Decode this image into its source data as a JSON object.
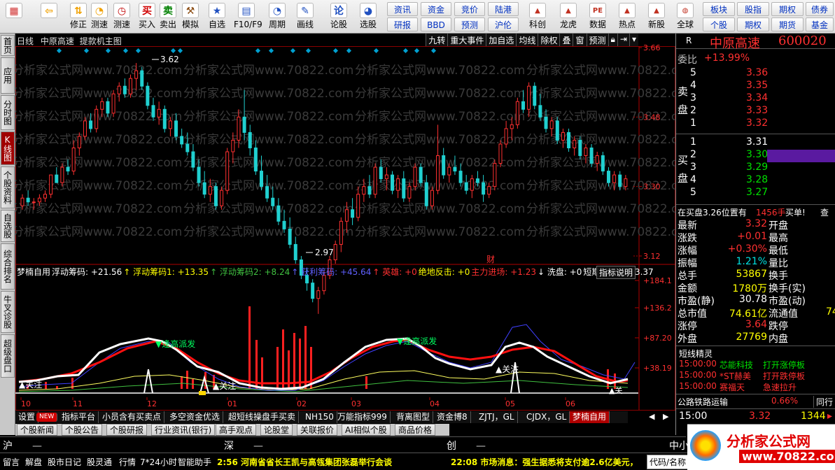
{
  "toolbar": {
    "big_buttons": [
      {
        "label": "",
        "icon": "colored-blocks-icon",
        "color": "#d03030"
      },
      {
        "label": "",
        "icon": "back-arrow-icon",
        "color": "#f0a000"
      },
      {
        "label": "修正",
        "icon": "up-down-arrow-icon",
        "color": "#f0a000"
      },
      {
        "label": "测速",
        "icon": "timer-icon",
        "color": "#f0a000"
      },
      {
        "label": "测速",
        "icon": "clock-icon",
        "color": "#c00000"
      },
      {
        "label": "买入",
        "icon": "buy-icon",
        "text": "买",
        "color": "#d00000"
      },
      {
        "label": "卖出",
        "icon": "sell-icon",
        "text": "卖",
        "color": "#008000"
      },
      {
        "label": "模拟",
        "icon": "hammer-icon",
        "color": "#8a4a10"
      },
      {
        "label": "自选",
        "icon": "star-icon",
        "color": "#2050c0"
      },
      {
        "label": "F10/F9",
        "icon": "f10-icon",
        "color": "#2050c0"
      },
      {
        "label": "周期",
        "icon": "period-clock-icon",
        "color": "#2050c0"
      },
      {
        "label": "画线",
        "icon": "pencil-icon",
        "color": "#2050c0"
      },
      {
        "label": "论股",
        "icon": "discuss-icon",
        "text": "论",
        "color": "#2050c0"
      },
      {
        "label": "选股",
        "icon": "speedometer-icon",
        "color": "#2050c0"
      }
    ],
    "small_buttons_col1": [
      "资讯",
      "研报"
    ],
    "small_buttons_col2": [
      "资金",
      "BBD"
    ],
    "small_buttons_col3": [
      "竞价",
      "预测"
    ],
    "small_buttons_col4": [
      "陆港",
      "沪伦"
    ],
    "right_buttons": [
      {
        "label": "科创",
        "icon": "stock-chart-icon"
      },
      {
        "label": "龙虎",
        "icon": "dragon-chart-icon"
      },
      {
        "label": "数据",
        "icon": "pe-data-icon"
      },
      {
        "label": "热点",
        "icon": "hot-icon"
      },
      {
        "label": "新股",
        "icon": "ipo-icon"
      },
      {
        "label": "全球",
        "icon": "globe-icon"
      }
    ],
    "far_right": [
      [
        "板块",
        "个股"
      ],
      [
        "股指",
        "期权"
      ],
      [
        "期权",
        "期货"
      ],
      [
        "债券",
        "基金"
      ]
    ]
  },
  "left_tabs": [
    "首页",
    "应用",
    "分时图",
    "K线图",
    "个股资料",
    "自选股",
    "综合排名",
    "牛叉诊股",
    "超级盘口"
  ],
  "active_left_tab": "K线图",
  "chart": {
    "period": "日线",
    "stock_name": "中原高速",
    "template": "提款机主图",
    "menu": [
      "九转",
      "重大事件",
      "加自选",
      "均线",
      "除权",
      "叠",
      "窗",
      "预测"
    ],
    "high_label": "3.62",
    "low_label": "2.97",
    "event_mark": "财",
    "price_axis": [
      "3.66",
      "3.48",
      "3.30",
      "3.12"
    ],
    "months": [
      "10",
      "11",
      "12",
      "01",
      "02",
      "03",
      "04",
      "05",
      "06"
    ],
    "watermark": "分析家公式网www.70822.com",
    "candles": [
      [
        3.25,
        3.28,
        3.24,
        3.27
      ],
      [
        3.27,
        3.29,
        3.25,
        3.26
      ],
      [
        3.26,
        3.27,
        3.24,
        3.26
      ],
      [
        3.26,
        3.28,
        3.25,
        3.27
      ],
      [
        3.27,
        3.29,
        3.26,
        3.28
      ],
      [
        3.28,
        3.33,
        3.27,
        3.33
      ],
      [
        3.33,
        3.35,
        3.31,
        3.31
      ],
      [
        3.31,
        3.36,
        3.3,
        3.35
      ],
      [
        3.35,
        3.37,
        3.33,
        3.34
      ],
      [
        3.34,
        3.42,
        3.33,
        3.4
      ],
      [
        3.4,
        3.44,
        3.38,
        3.43
      ],
      [
        3.43,
        3.48,
        3.42,
        3.47
      ],
      [
        3.47,
        3.49,
        3.44,
        3.45
      ],
      [
        3.45,
        3.51,
        3.44,
        3.5
      ],
      [
        3.5,
        3.53,
        3.48,
        3.52
      ],
      [
        3.52,
        3.53,
        3.48,
        3.49
      ],
      [
        3.49,
        3.55,
        3.48,
        3.54
      ],
      [
        3.54,
        3.57,
        3.52,
        3.56
      ],
      [
        3.56,
        3.58,
        3.53,
        3.54
      ],
      [
        3.54,
        3.59,
        3.53,
        3.58
      ],
      [
        3.58,
        3.62,
        3.55,
        3.6
      ],
      [
        3.6,
        3.61,
        3.55,
        3.56
      ],
      [
        3.56,
        3.57,
        3.5,
        3.51
      ],
      [
        3.51,
        3.53,
        3.47,
        3.48
      ],
      [
        3.48,
        3.52,
        3.46,
        3.5
      ],
      [
        3.5,
        3.51,
        3.44,
        3.45
      ],
      [
        3.45,
        3.48,
        3.43,
        3.47
      ],
      [
        3.47,
        3.49,
        3.42,
        3.43
      ],
      [
        3.43,
        3.45,
        3.4,
        3.41
      ],
      [
        3.41,
        3.44,
        3.38,
        3.39
      ],
      [
        3.39,
        3.41,
        3.34,
        3.35
      ],
      [
        3.35,
        3.37,
        3.3,
        3.31
      ],
      [
        3.31,
        3.34,
        3.27,
        3.28
      ],
      [
        3.28,
        3.32,
        3.26,
        3.3
      ],
      [
        3.3,
        3.31,
        3.24,
        3.25
      ],
      [
        3.25,
        3.3,
        3.24,
        3.29
      ],
      [
        3.29,
        3.4,
        3.28,
        3.39
      ],
      [
        3.39,
        3.44,
        3.36,
        3.42
      ],
      [
        3.42,
        3.5,
        3.4,
        3.48
      ],
      [
        3.48,
        3.55,
        3.42,
        3.44
      ],
      [
        3.44,
        3.46,
        3.38,
        3.4
      ],
      [
        3.4,
        3.42,
        3.33,
        3.34
      ],
      [
        3.34,
        3.38,
        3.29,
        3.3
      ],
      [
        3.3,
        3.33,
        3.26,
        3.27
      ],
      [
        3.27,
        3.3,
        3.24,
        3.25
      ],
      [
        3.25,
        3.27,
        3.2,
        3.21
      ],
      [
        3.21,
        3.24,
        3.18,
        3.19
      ],
      [
        3.19,
        3.22,
        3.14,
        3.15
      ],
      [
        3.15,
        3.17,
        3.1,
        3.11
      ],
      [
        3.11,
        3.12,
        3.06,
        3.07
      ],
      [
        3.07,
        3.09,
        3.03,
        3.05
      ],
      [
        3.05,
        3.06,
        3.0,
        3.01
      ],
      [
        3.01,
        3.04,
        2.97,
        3.03
      ],
      [
        3.03,
        3.08,
        3.02,
        3.07
      ],
      [
        3.07,
        3.12,
        3.06,
        3.11
      ],
      [
        3.11,
        3.16,
        3.1,
        3.15
      ],
      [
        3.15,
        3.22,
        3.13,
        3.21
      ],
      [
        3.21,
        3.26,
        3.18,
        3.24
      ],
      [
        3.24,
        3.27,
        3.2,
        3.22
      ],
      [
        3.22,
        3.3,
        3.21,
        3.28
      ],
      [
        3.28,
        3.32,
        3.26,
        3.3
      ],
      [
        3.3,
        3.33,
        3.27,
        3.28
      ],
      [
        3.28,
        3.36,
        3.27,
        3.35
      ],
      [
        3.35,
        3.37,
        3.31,
        3.32
      ],
      [
        3.32,
        3.35,
        3.29,
        3.33
      ],
      [
        3.33,
        3.34,
        3.28,
        3.29
      ],
      [
        3.29,
        3.33,
        3.27,
        3.32
      ],
      [
        3.32,
        3.34,
        3.26,
        3.27
      ],
      [
        3.27,
        3.31,
        3.26,
        3.3
      ],
      [
        3.3,
        3.36,
        3.29,
        3.35
      ],
      [
        3.35,
        3.36,
        3.3,
        3.31
      ],
      [
        3.31,
        3.33,
        3.24,
        3.25
      ],
      [
        3.25,
        3.3,
        3.24,
        3.29
      ],
      [
        3.29,
        3.46,
        3.28,
        3.38
      ],
      [
        3.38,
        3.4,
        3.32,
        3.33
      ],
      [
        3.33,
        3.36,
        3.31,
        3.35
      ],
      [
        3.35,
        3.38,
        3.33,
        3.34
      ],
      [
        3.34,
        3.36,
        3.3,
        3.31
      ],
      [
        3.31,
        3.33,
        3.28,
        3.29
      ],
      [
        3.29,
        3.33,
        3.27,
        3.32
      ],
      [
        3.32,
        3.34,
        3.3,
        3.31
      ],
      [
        3.31,
        3.33,
        3.26,
        3.28
      ],
      [
        3.28,
        3.31,
        3.27,
        3.3
      ],
      [
        3.3,
        3.37,
        3.29,
        3.36
      ],
      [
        3.36,
        3.42,
        3.35,
        3.41
      ],
      [
        3.41,
        3.47,
        3.4,
        3.45
      ],
      [
        3.45,
        3.48,
        3.42,
        3.46
      ],
      [
        3.46,
        3.53,
        3.45,
        3.52
      ],
      [
        3.52,
        3.55,
        3.49,
        3.5
      ],
      [
        3.5,
        3.57,
        3.48,
        3.56
      ],
      [
        3.56,
        3.57,
        3.5,
        3.51
      ],
      [
        3.51,
        3.54,
        3.47,
        3.48
      ],
      [
        3.48,
        3.5,
        3.44,
        3.45
      ],
      [
        3.45,
        3.48,
        3.43,
        3.47
      ],
      [
        3.47,
        3.48,
        3.41,
        3.42
      ],
      [
        3.42,
        3.45,
        3.4,
        3.44
      ],
      [
        3.44,
        3.45,
        3.39,
        3.4
      ],
      [
        3.4,
        3.43,
        3.38,
        3.42
      ],
      [
        3.42,
        3.43,
        3.37,
        3.38
      ],
      [
        3.38,
        3.41,
        3.36,
        3.4
      ],
      [
        3.4,
        3.41,
        3.35,
        3.36
      ],
      [
        3.36,
        3.39,
        3.34,
        3.38
      ],
      [
        3.38,
        3.39,
        3.33,
        3.34
      ],
      [
        3.34,
        3.35,
        3.3,
        3.31
      ],
      [
        3.31,
        3.34,
        3.29,
        3.33
      ],
      [
        3.33,
        3.34,
        3.29,
        3.3
      ],
      [
        3.3,
        3.33,
        3.29,
        3.32
      ]
    ]
  },
  "indicator": {
    "name": "梦楠自用",
    "items": [
      {
        "text": "浮动筹码: +21.56",
        "color": "#ffffff"
      },
      {
        "text": "↑ 浮动筹码1: +13.35",
        "color": "#ffff00"
      },
      {
        "text": "↑ 浮动筹码2: +8.24",
        "color": "#40c040"
      },
      {
        "text": "↑ 获利筹码: +45.64",
        "color": "#6060ff"
      },
      {
        "text": "↑ 英雄: +0",
        "color": "#ff3030"
      },
      {
        "text": "绝地反击: +0",
        "color": "#ffff00"
      },
      {
        "text": "主力进场: +1.23",
        "color": "#ff3030"
      },
      {
        "text": "↓ 洗盘: +0",
        "color": "#ffffff"
      },
      {
        "text": "短期趋势: +23.37",
        "color": "#ffffff"
      }
    ],
    "explain": "指标说明",
    "axis": [
      "184.1",
      "136.2",
      "87.20",
      "38.19"
    ],
    "label_top": "逢高派发",
    "label_top2": "逢高派发",
    "label_focus": "关注",
    "label_focus2": "关注",
    "label_focus3": "关注",
    "label_focus4": "关"
  },
  "quote": {
    "name": "中原高速",
    "code": "600020",
    "r_label": "R",
    "weibi_label": "委比",
    "weibi": "+13.99%",
    "sell_label": "卖盘",
    "buy_label": "买盘",
    "sells": [
      [
        "5",
        "3.36"
      ],
      [
        "4",
        "3.35"
      ],
      [
        "3",
        "3.34"
      ],
      [
        "2",
        "3.33"
      ],
      [
        "1",
        "3.32"
      ]
    ],
    "buys": [
      [
        "1",
        "3.31"
      ],
      [
        "2",
        "3.30"
      ],
      [
        "3",
        "3.29"
      ],
      [
        "4",
        "3.28"
      ],
      [
        "5",
        "3.27"
      ]
    ],
    "buy_notice": "在买盘3.26位置有",
    "buy_notice_vol": "1456手",
    "buy_notice_action": "买单!",
    "buy_notice_more": "查",
    "stats": [
      [
        "最新",
        "3.32",
        "开盘",
        ""
      ],
      [
        "涨跌",
        "+0.01",
        "最高",
        ""
      ],
      [
        "涨幅",
        "+0.30%",
        "最低",
        ""
      ],
      [
        "振幅",
        "1.21%",
        "量比",
        ""
      ],
      [
        "总手",
        "53867",
        "换手",
        ""
      ],
      [
        "金额",
        "1780万",
        "换手(实)",
        ""
      ],
      [
        "市盈(静)",
        "30.78",
        "市盈(动)",
        ""
      ],
      [
        "总市值",
        "74.61亿",
        "流通值",
        "74"
      ],
      [
        "涨停",
        "3.64",
        "跌停",
        ""
      ],
      [
        "外盘",
        "27769",
        "内盘",
        ""
      ]
    ],
    "sprite_title": "短线精灵",
    "sprites": [
      [
        "15:00:00",
        "芯能科技",
        "打开涨停板"
      ],
      [
        "15:00:00",
        "*ST赫美",
        "打开跌停板"
      ],
      [
        "15:00:00",
        "赛福天",
        "急速拉升"
      ]
    ],
    "sector": "公路铁路运输",
    "sector_pct": "0.66%",
    "tongxing": "同行",
    "last_time": "15:00",
    "last_price": "3.32",
    "last_vol": "1344",
    "logo_text": "分析家公式网",
    "logo_url": "www.70822.com"
  },
  "bottom_tabs1": [
    "设置",
    "NEW",
    "指标平台",
    "小员含有买卖点",
    "多空资金优选",
    "超短线操盘手买卖",
    "NH150",
    "万能指标999",
    "背离图型",
    "资金博8",
    "ZJTJ，GL",
    "CJDX，GL",
    "梦楠自用"
  ],
  "bottom_tabs2": [
    "个股新闻",
    "个股公告",
    "个股研报",
    "行业资讯(银行)",
    "高手观点",
    "论股堂",
    "关联报价",
    "AI相似个股",
    "商品价格"
  ],
  "index_bar": [
    [
      "沪",
      "—"
    ],
    [
      "深",
      "—"
    ],
    [
      "创",
      "—"
    ],
    [
      "中小",
      ""
    ]
  ],
  "status": {
    "items": [
      "留言",
      "解盘",
      "股市日记",
      "股灵通",
      "行情",
      "7*24小时",
      "智能助手"
    ],
    "news1": "2:56 河南省省长王凯与高瓴集团张磊举行会谈",
    "news2": "22:08 市场消息：强生据悉将支付逾2.6亿美元，",
    "code_input": "代码/名称"
  }
}
